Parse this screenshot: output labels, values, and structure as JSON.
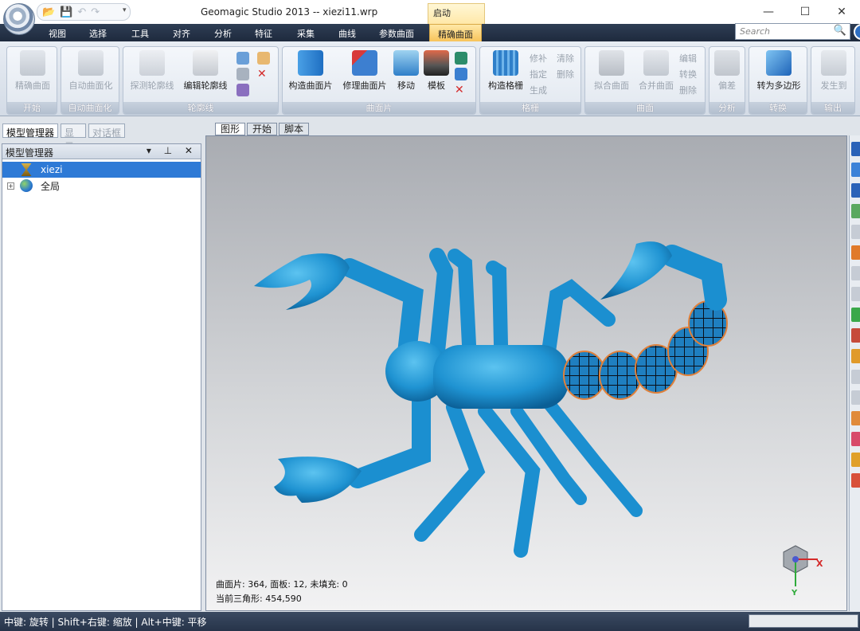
{
  "window": {
    "title": "Geomagic Studio 2013 -- xiezi11.wrp",
    "context_tab_header": "启动",
    "minimize": "—",
    "maximize": "☐",
    "close": "✕"
  },
  "quick_access": {
    "items": [
      "open-icon",
      "save-icon",
      "undo-icon",
      "redo-icon"
    ],
    "more": "▾"
  },
  "menu_tabs": [
    "视图",
    "选择",
    "工具",
    "对齐",
    "分析",
    "特征",
    "采集",
    "曲线",
    "参数曲面",
    "精确曲面"
  ],
  "active_tab": "精确曲面",
  "search": {
    "placeholder": "Search"
  },
  "ribbon": {
    "groups": [
      {
        "label": "开始",
        "buttons": [
          "精确曲面"
        ]
      },
      {
        "label": "自动曲面化",
        "buttons": [
          "自动曲面化"
        ]
      },
      {
        "label": "轮廓线",
        "buttons": [
          "探测轮廓线",
          "编辑轮廓线"
        ]
      },
      {
        "label": "曲面片",
        "buttons": [
          "构造曲面片",
          "修理曲面片",
          "移动",
          "模板"
        ]
      },
      {
        "label": "格栅",
        "buttons": [
          "构造格栅"
        ],
        "small": [
          "修补",
          "清除",
          "指定",
          "删除",
          "生成"
        ]
      },
      {
        "label": "曲面",
        "buttons": [
          "拟合曲面",
          "合并曲面"
        ],
        "small": [
          "编辑",
          "转换",
          "删除"
        ]
      },
      {
        "label": "分析",
        "buttons": [
          "偏差"
        ]
      },
      {
        "label": "转换",
        "buttons": [
          "转为多边形"
        ]
      },
      {
        "label": "输出",
        "buttons": [
          "发生到"
        ]
      }
    ]
  },
  "left_panel": {
    "tabs": [
      "模型管理器",
      "显示",
      "对话框"
    ],
    "header": "模型管理器",
    "header_controls": "▾ ⊥ ✕",
    "tree": [
      {
        "label": "xiezi",
        "selected": true
      },
      {
        "label": "全局",
        "selected": false,
        "expander": "+"
      }
    ]
  },
  "viewport": {
    "tabs": [
      "图形",
      "开始",
      "脚本"
    ],
    "info_line1": "曲面片: 364, 面板: 12, 未填充: 0",
    "info_line2": "当前三角形: 454,590",
    "axis_x": "X",
    "axis_y": "Y"
  },
  "status": {
    "hint": "中键: 旋转 | Shift+右键: 缩放 | Alt+中键: 平移"
  }
}
